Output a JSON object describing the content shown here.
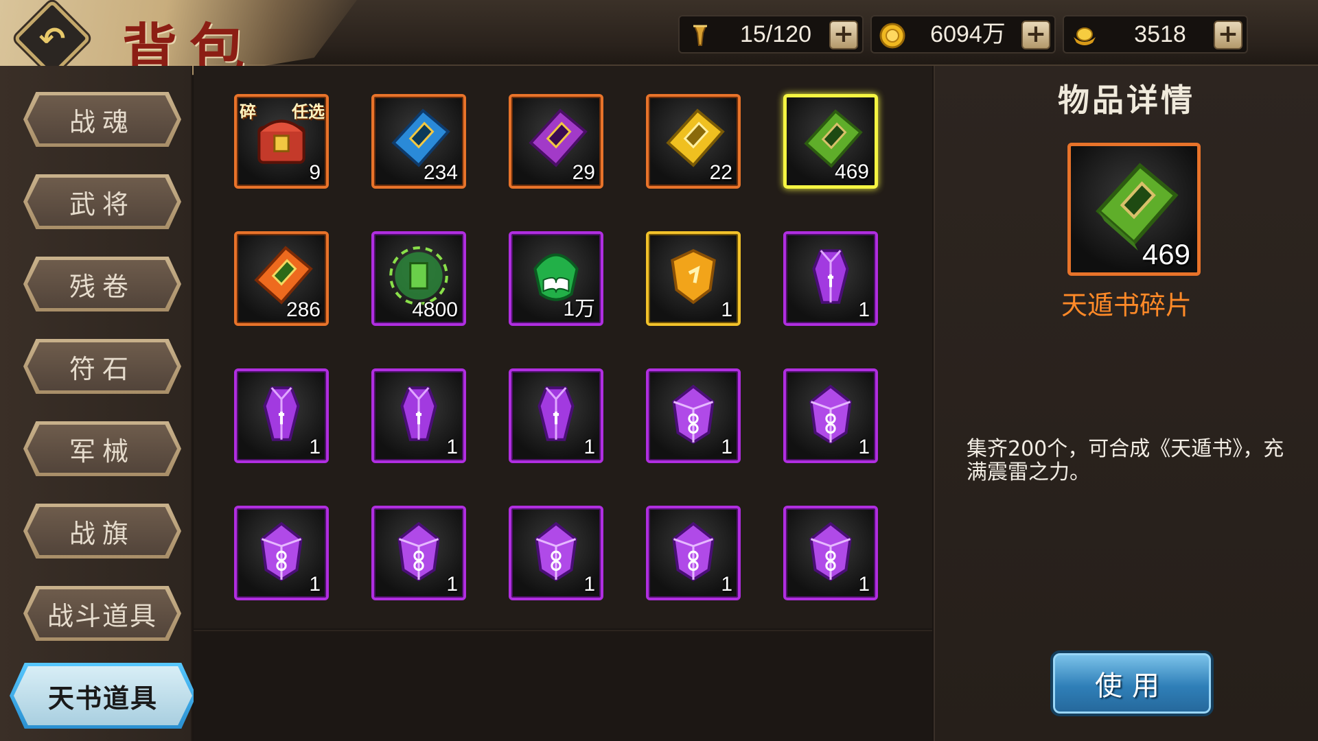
{
  "header": {
    "title": "背包",
    "back_icon": "↶",
    "resources": [
      {
        "name": "stamina",
        "icon": "torch-icon",
        "value": "15/120"
      },
      {
        "name": "coins",
        "icon": "coin-icon",
        "value": "6094万"
      },
      {
        "name": "ingots",
        "icon": "gold-ingot-icon",
        "value": "3518"
      }
    ],
    "plus_label": "+"
  },
  "sidebar": {
    "items": [
      {
        "label": "战魂",
        "active": false
      },
      {
        "label": "武将",
        "active": false
      },
      {
        "label": "残卷",
        "active": false
      },
      {
        "label": "符石",
        "active": false
      },
      {
        "label": "军械",
        "active": false
      },
      {
        "label": "战旗",
        "active": false
      },
      {
        "label": "战斗道具",
        "active": false
      },
      {
        "label": "天书道具",
        "active": true
      }
    ]
  },
  "inventory": {
    "slots": [
      {
        "icon": "treasure-chest-icon",
        "rarity": "orange",
        "count": "9",
        "tag_left": "碎",
        "tag_right": "任选"
      },
      {
        "icon": "blue-scroll-fragment-icon",
        "rarity": "orange",
        "count": "234"
      },
      {
        "icon": "purple-scroll-fragment-icon",
        "rarity": "orange",
        "count": "29"
      },
      {
        "icon": "yellow-scroll-fragment-icon",
        "rarity": "orange",
        "count": "22"
      },
      {
        "icon": "green-scroll-fragment-icon",
        "rarity": "selected",
        "count": "469"
      },
      {
        "icon": "orange-scroll-fragment-icon",
        "rarity": "orange",
        "count": "286"
      },
      {
        "icon": "green-energy-orb-icon",
        "rarity": "purple",
        "count": "4800"
      },
      {
        "icon": "green-book-gem-icon",
        "rarity": "purple",
        "count": "1万"
      },
      {
        "icon": "gold-rune-shield-icon",
        "rarity": "gold",
        "count": "1"
      },
      {
        "icon": "purple-crystal-icon",
        "rarity": "purple",
        "count": "1"
      },
      {
        "icon": "purple-crystal-icon",
        "rarity": "purple",
        "count": "1"
      },
      {
        "icon": "purple-crystal-icon",
        "rarity": "purple",
        "count": "1"
      },
      {
        "icon": "purple-crystal-icon",
        "rarity": "purple",
        "count": "1"
      },
      {
        "icon": "purple-gem-icon",
        "rarity": "purple",
        "count": "1"
      },
      {
        "icon": "purple-gem-icon",
        "rarity": "purple",
        "count": "1"
      },
      {
        "icon": "purple-gem-icon",
        "rarity": "purple",
        "count": "1"
      },
      {
        "icon": "purple-gem-icon",
        "rarity": "purple",
        "count": "1"
      },
      {
        "icon": "purple-gem-icon",
        "rarity": "purple",
        "count": "1"
      },
      {
        "icon": "purple-gem-icon",
        "rarity": "purple",
        "count": "1"
      },
      {
        "icon": "purple-gem-icon",
        "rarity": "purple",
        "count": "1"
      }
    ]
  },
  "detail": {
    "title": "物品详情",
    "item_icon": "green-scroll-fragment-icon",
    "item_count": "469",
    "item_name": "天遁书碎片",
    "description": "集齐200个，可合成《天遁书》，充满震雷之力。",
    "use_label": "使用"
  },
  "colors": {
    "orange_border": "#e8732a",
    "purple_border": "#b02ee0",
    "gold_border": "#f2c22a",
    "selected_border": "#f5f542",
    "item_name": "#ff8a28",
    "active_tab": "#57c8ff"
  }
}
